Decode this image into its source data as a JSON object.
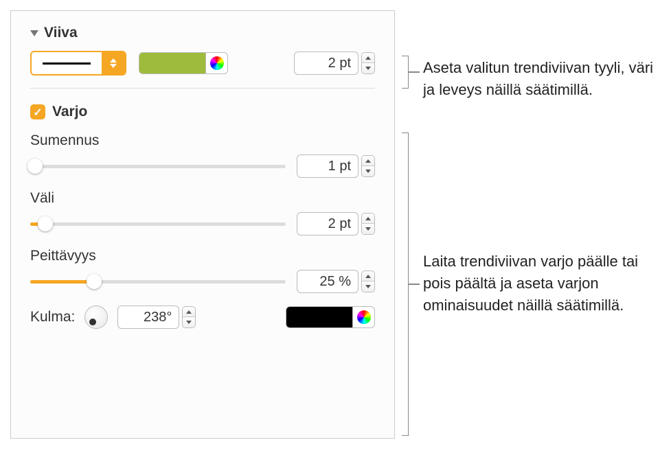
{
  "line_section": {
    "title": "Viiva",
    "width_value": "2 pt",
    "color": "#9fbb3c"
  },
  "shadow_section": {
    "title": "Varjo",
    "checked": true,
    "blur": {
      "label": "Sumennus",
      "value": "1 pt",
      "slider_pct": 2
    },
    "offset": {
      "label": "Väli",
      "value": "2 pt",
      "slider_pct": 6
    },
    "opacity": {
      "label": "Peittävyys",
      "value": "25 %",
      "slider_pct": 25
    },
    "angle": {
      "label": "Kulma:",
      "value": "238°"
    },
    "shadow_color": "#000000"
  },
  "annotations": {
    "line_help": "Aseta valitun trendiviivan tyyli, väri ja leveys näillä säätimillä.",
    "shadow_help": "Laita trendiviivan varjo päälle tai pois päältä ja aseta varjon ominaisuudet näillä säätimillä."
  }
}
